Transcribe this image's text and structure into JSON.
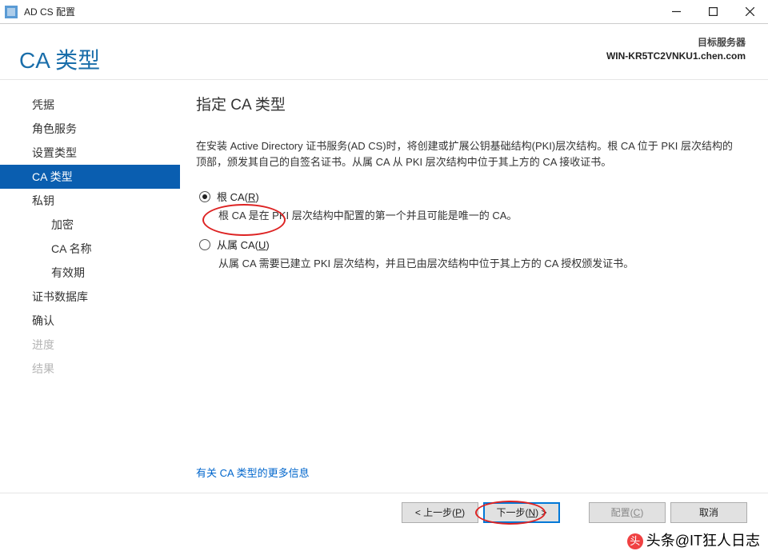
{
  "titlebar": {
    "text": "AD CS 配置"
  },
  "header": {
    "page_title": "CA 类型",
    "server_label": "目标服务器",
    "server_name": "WIN-KR5TC2VNKU1.chen.com"
  },
  "sidebar": {
    "items": [
      {
        "label": "凭据",
        "state": "normal"
      },
      {
        "label": "角色服务",
        "state": "normal"
      },
      {
        "label": "设置类型",
        "state": "normal"
      },
      {
        "label": "CA 类型",
        "state": "active"
      },
      {
        "label": "私钥",
        "state": "normal"
      },
      {
        "label": "加密",
        "state": "normal",
        "sub": true
      },
      {
        "label": "CA 名称",
        "state": "normal",
        "sub": true
      },
      {
        "label": "有效期",
        "state": "normal",
        "sub": true
      },
      {
        "label": "证书数据库",
        "state": "normal"
      },
      {
        "label": "确认",
        "state": "normal"
      },
      {
        "label": "进度",
        "state": "disabled"
      },
      {
        "label": "结果",
        "state": "disabled"
      }
    ]
  },
  "content": {
    "heading": "指定 CA 类型",
    "intro": "在安装 Active Directory 证书服务(AD CS)时，将创建或扩展公钥基础结构(PKI)层次结构。根 CA 位于 PKI 层次结构的顶部，颁发其自己的自签名证书。从属 CA 从 PKI 层次结构中位于其上方的 CA 接收证书。",
    "options": [
      {
        "label_pre": "根 CA(",
        "access": "R",
        "label_post": ")",
        "desc": "根 CA 是在 PKI 层次结构中配置的第一个并且可能是唯一的 CA。",
        "checked": true
      },
      {
        "label_pre": "从属 CA(",
        "access": "U",
        "label_post": ")",
        "desc": "从属 CA 需要已建立 PKI 层次结构，并且已由层次结构中位于其上方的 CA 授权颁发证书。",
        "checked": false
      }
    ],
    "more_link": "有关 CA 类型的更多信息"
  },
  "footer": {
    "prev_pre": "< 上一步(",
    "prev_key": "P",
    "prev_post": ")",
    "next_pre": "下一步(",
    "next_key": "N",
    "next_post": ") >",
    "configure_pre": "配置(",
    "configure_key": "C",
    "configure_post": ")",
    "cancel": "取消"
  },
  "watermark": "头条@IT狂人日志"
}
